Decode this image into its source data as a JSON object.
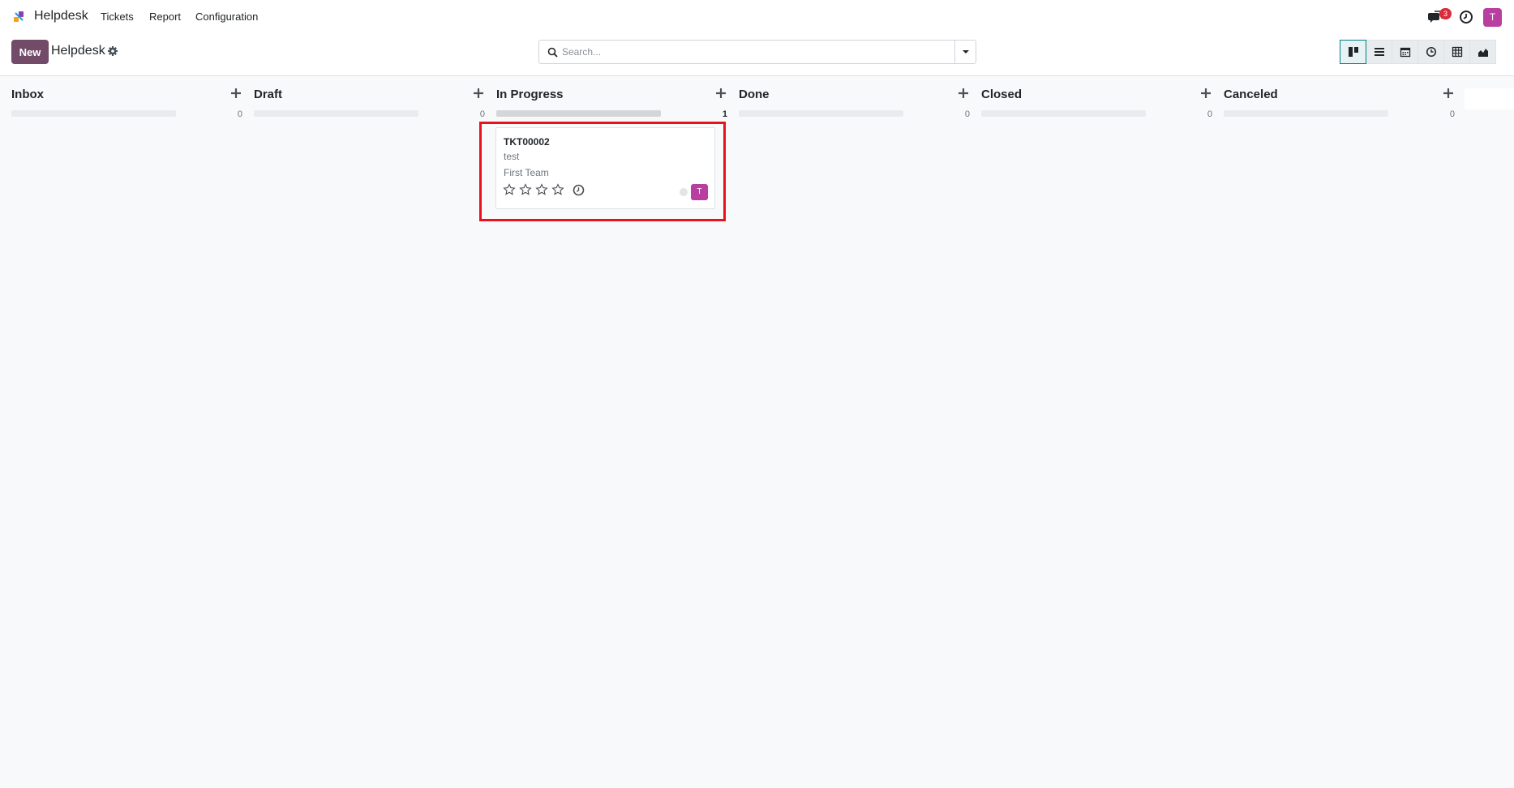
{
  "topnav": {
    "app_name": "Helpdesk",
    "menu": [
      "Tickets",
      "Report",
      "Configuration"
    ],
    "notification_count": "3",
    "user_initial": "T",
    "icons": [
      "chat-icon",
      "clock-icon"
    ]
  },
  "control_panel": {
    "new_label": "New",
    "breadcrumb": "Helpdesk",
    "search_placeholder": "Search...",
    "views": [
      "kanban-view-icon",
      "list-view-icon",
      "calendar-view-icon",
      "activity-view-icon",
      "pivot-view-icon",
      "graph-view-icon"
    ],
    "active_view": "kanban-view-icon"
  },
  "columns": [
    {
      "title": "Inbox",
      "count": "0",
      "fill": 0
    },
    {
      "title": "Draft",
      "count": "0",
      "fill": 0
    },
    {
      "title": "In Progress",
      "count": "1",
      "fill": 1
    },
    {
      "title": "Done",
      "count": "0",
      "fill": 0
    },
    {
      "title": "Closed",
      "count": "0",
      "fill": 0
    },
    {
      "title": "Canceled",
      "count": "0",
      "fill": 0
    }
  ],
  "card": {
    "reference": "TKT00002",
    "name": "test",
    "team": "First Team",
    "priority_stars": 4,
    "priority_filled": 0,
    "assignee_initial": "T"
  },
  "colors": {
    "brand": "#714b67",
    "accent": "#017e84",
    "avatar": "#b83fa0",
    "badge": "#d92c3a",
    "highlight": "#e8111c"
  }
}
